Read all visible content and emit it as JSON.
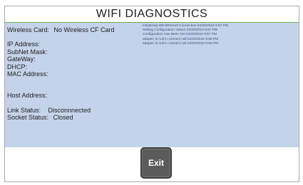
{
  "app": {
    "title": "WIFI DIAGNOSTICS"
  },
  "info": {
    "wireless_card_label": "Wireless Card:",
    "wireless_card_value": "No Wireless CF Card",
    "ip_label": "IP Address:",
    "subnet_label": "SubNet Mask:",
    "gateway_label": "GateWay:",
    "dhcp_label": "DHCP:",
    "mac_label": "MAC Address:",
    "host_label": "Host Address:",
    "link_label": "Link Status:",
    "link_value": "Disconnnected",
    "socket_label": "Socket Status:",
    "socket_value": "Closed"
  },
  "log": [
    "Initializing Wifi Ethernet Connection 04/20/2010 9:57 PM",
    "Setting Configuration Values 04/20/2010 9:57 PM",
    "Configuration Has Been Set 04/20/2010 9:57 PM",
    "adapter is null in connect call 04/20/2010 9:58 PM",
    "adapter is null in connect call 04/20/2010 9:58 PM"
  ],
  "footer": {
    "exit_label": "Exit"
  },
  "colors": {
    "panel": "#c5d3ea",
    "accent": "#6aa84f",
    "button": "#5b5b5b"
  }
}
